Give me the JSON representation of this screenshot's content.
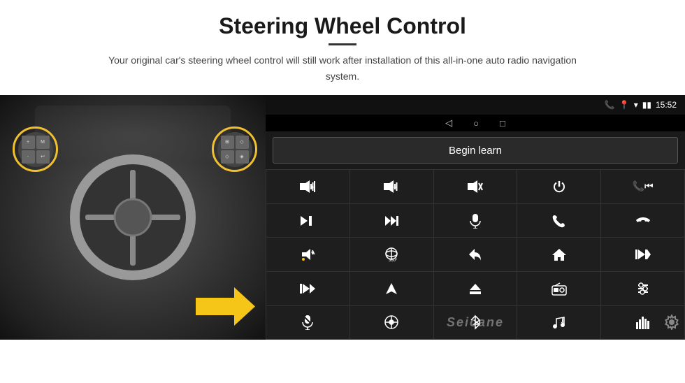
{
  "header": {
    "title": "Steering Wheel Control",
    "divider": true,
    "subtitle": "Your original car's steering wheel control will still work after installation of this all-in-one auto radio navigation system."
  },
  "status_bar": {
    "time": "15:52",
    "nav_icons": [
      "◁",
      "○",
      "□"
    ]
  },
  "begin_learn": {
    "label": "Begin learn"
  },
  "controls": [
    {
      "icon": "🔊+",
      "name": "vol-up"
    },
    {
      "icon": "🔊-",
      "name": "vol-down"
    },
    {
      "icon": "🔇",
      "name": "mute"
    },
    {
      "icon": "⏻",
      "name": "power"
    },
    {
      "icon": "📞⏮",
      "name": "call-prev"
    },
    {
      "icon": "⏭",
      "name": "next"
    },
    {
      "icon": "⏩⏭",
      "name": "fast-fwd"
    },
    {
      "icon": "🎤",
      "name": "mic"
    },
    {
      "icon": "📞",
      "name": "call"
    },
    {
      "icon": "↩",
      "name": "hang-up"
    },
    {
      "icon": "📢",
      "name": "horn"
    },
    {
      "icon": "🔄",
      "name": "360"
    },
    {
      "icon": "↶",
      "name": "back"
    },
    {
      "icon": "🏠",
      "name": "home"
    },
    {
      "icon": "⏮⏮",
      "name": "prev-prev"
    },
    {
      "icon": "⏭⏭",
      "name": "skip-fwd"
    },
    {
      "icon": "▶",
      "name": "play"
    },
    {
      "icon": "⏏",
      "name": "eject"
    },
    {
      "icon": "📻",
      "name": "radio"
    },
    {
      "icon": "⚙",
      "name": "settings"
    },
    {
      "icon": "🎤",
      "name": "mic2"
    },
    {
      "icon": "🎛",
      "name": "wheel"
    },
    {
      "icon": "🔵",
      "name": "bluetooth"
    },
    {
      "icon": "🎵",
      "name": "music"
    },
    {
      "icon": "📊",
      "name": "equalizer"
    }
  ],
  "watermark": "Seicane",
  "colors": {
    "screen_bg": "#1a1a1a",
    "status_bar": "#000",
    "grid_gap": "#333",
    "btn_bg": "#1e1e1e",
    "begin_btn_bg": "#2a2a2a",
    "yellow": "#f5c518"
  }
}
